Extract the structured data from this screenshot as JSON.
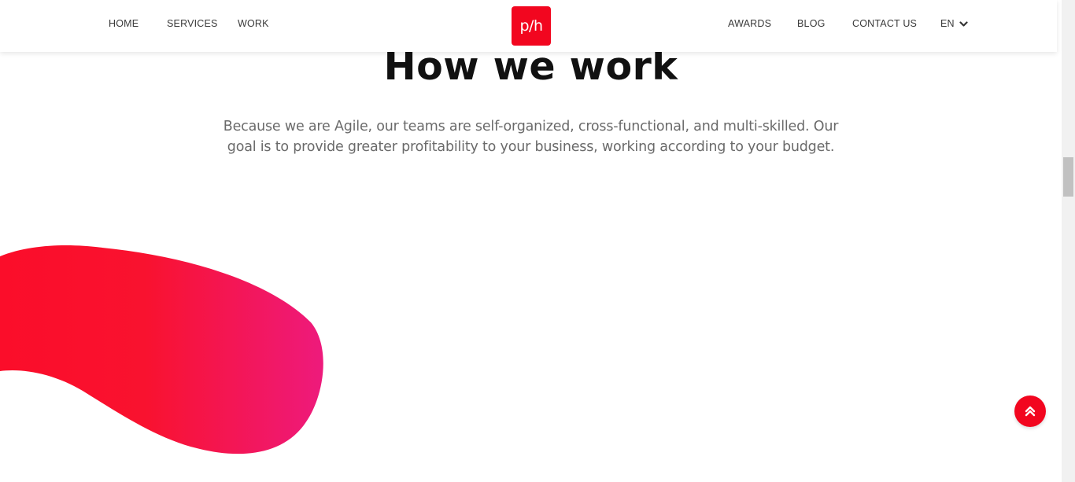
{
  "header": {
    "nav_left": [
      "HOME",
      "SERVICES",
      "WORK"
    ],
    "logo_text": "p/h",
    "nav_right": [
      "AWARDS",
      "BLOG",
      "CONTACT US"
    ],
    "language": "EN"
  },
  "section": {
    "title": "How we work",
    "description_line1": "Because we are Agile, our teams are self-organized, cross-functional, and multi-skilled. Our",
    "description_line2": "goal is to provide greater profitability to your business, working according to your budget."
  },
  "icons": {
    "lang_dropdown": "chevron-down-icon",
    "scroll_top": "double-chevron-up-icon"
  },
  "colors": {
    "brand_red": "#f2061f",
    "blob_gradient_start": "#fb0d2a",
    "blob_gradient_end": "#ee1a7c",
    "text_dark": "#111111",
    "text_muted": "#6a6a6a"
  }
}
